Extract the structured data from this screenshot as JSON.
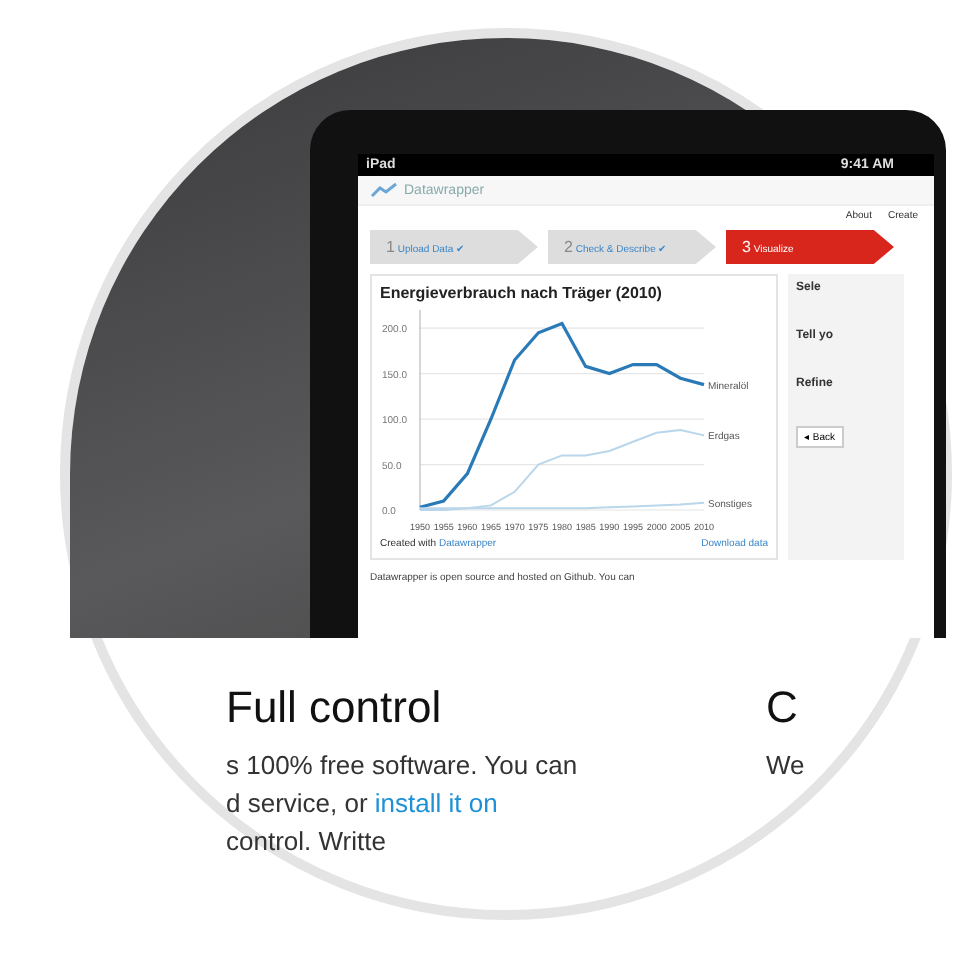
{
  "tablet": {
    "status_bar": {
      "device": "iPad",
      "time": "9:41 AM"
    },
    "app": {
      "logo": "Datawrapper",
      "nav": [
        "About",
        "Create"
      ],
      "steps": [
        {
          "number": "1",
          "label": "Upload Data ✔",
          "selected": false
        },
        {
          "number": "2",
          "label": "Check & Describe ✔",
          "selected": false
        },
        {
          "number": "3",
          "label": "Visualize",
          "selected": true
        }
      ],
      "chart_card": {
        "title": "Energieverbrauch nach Träger (2010)",
        "credit": "Created with",
        "credit_link": "Datawrapper",
        "download": "Download data",
        "chart_data": {
          "type": "line",
          "grid": true,
          "x": [
            1950,
            1955,
            1960,
            1965,
            1970,
            1975,
            1980,
            1985,
            1990,
            1995,
            2000,
            2005,
            2010
          ],
          "xlim": [
            1950,
            2010
          ],
          "ylim": [
            0,
            220
          ],
          "yticks": [
            {
              "value": 0,
              "label": "0.0"
            },
            {
              "value": 50,
              "label": "50.0"
            },
            {
              "value": 100,
              "label": "100.0"
            },
            {
              "value": 150,
              "label": "150.0"
            },
            {
              "value": 200,
              "label": "200.0"
            }
          ],
          "xticks": [
            1950,
            1955,
            1960,
            1965,
            1970,
            1975,
            1980,
            1985,
            1990,
            1995,
            2000,
            2005,
            2010
          ],
          "series": [
            {
              "name": "Mineralöl",
              "color": "#2a7ab8",
              "values": [
                3,
                10,
                40,
                100,
                165,
                195,
                205,
                158,
                150,
                160,
                160,
                145,
                138
              ]
            },
            {
              "name": "Erdgas",
              "color": "#b9d6ea",
              "values": [
                0,
                0,
                2,
                5,
                20,
                50,
                60,
                60,
                65,
                75,
                85,
                88,
                82
              ]
            },
            {
              "name": "Sonstiges",
              "color": "#b9d6ea",
              "values": [
                2,
                2,
                2,
                2,
                2,
                2,
                2,
                2,
                3,
                4,
                5,
                6,
                8
              ]
            }
          ]
        }
      },
      "side_panel": {
        "headings": [
          "Sele",
          "Tell yo",
          "Refine"
        ],
        "back": "◂ Back"
      },
      "footer": "Datawrapper is open source and hosted on Github. You can"
    }
  },
  "section": {
    "heading": "Full control",
    "text_start": "s 100% free software. You can",
    "text_mid": "d service, or",
    "link": "install it on",
    "text_end": "control. Writte",
    "next_heading": "C",
    "next_text": "We"
  }
}
